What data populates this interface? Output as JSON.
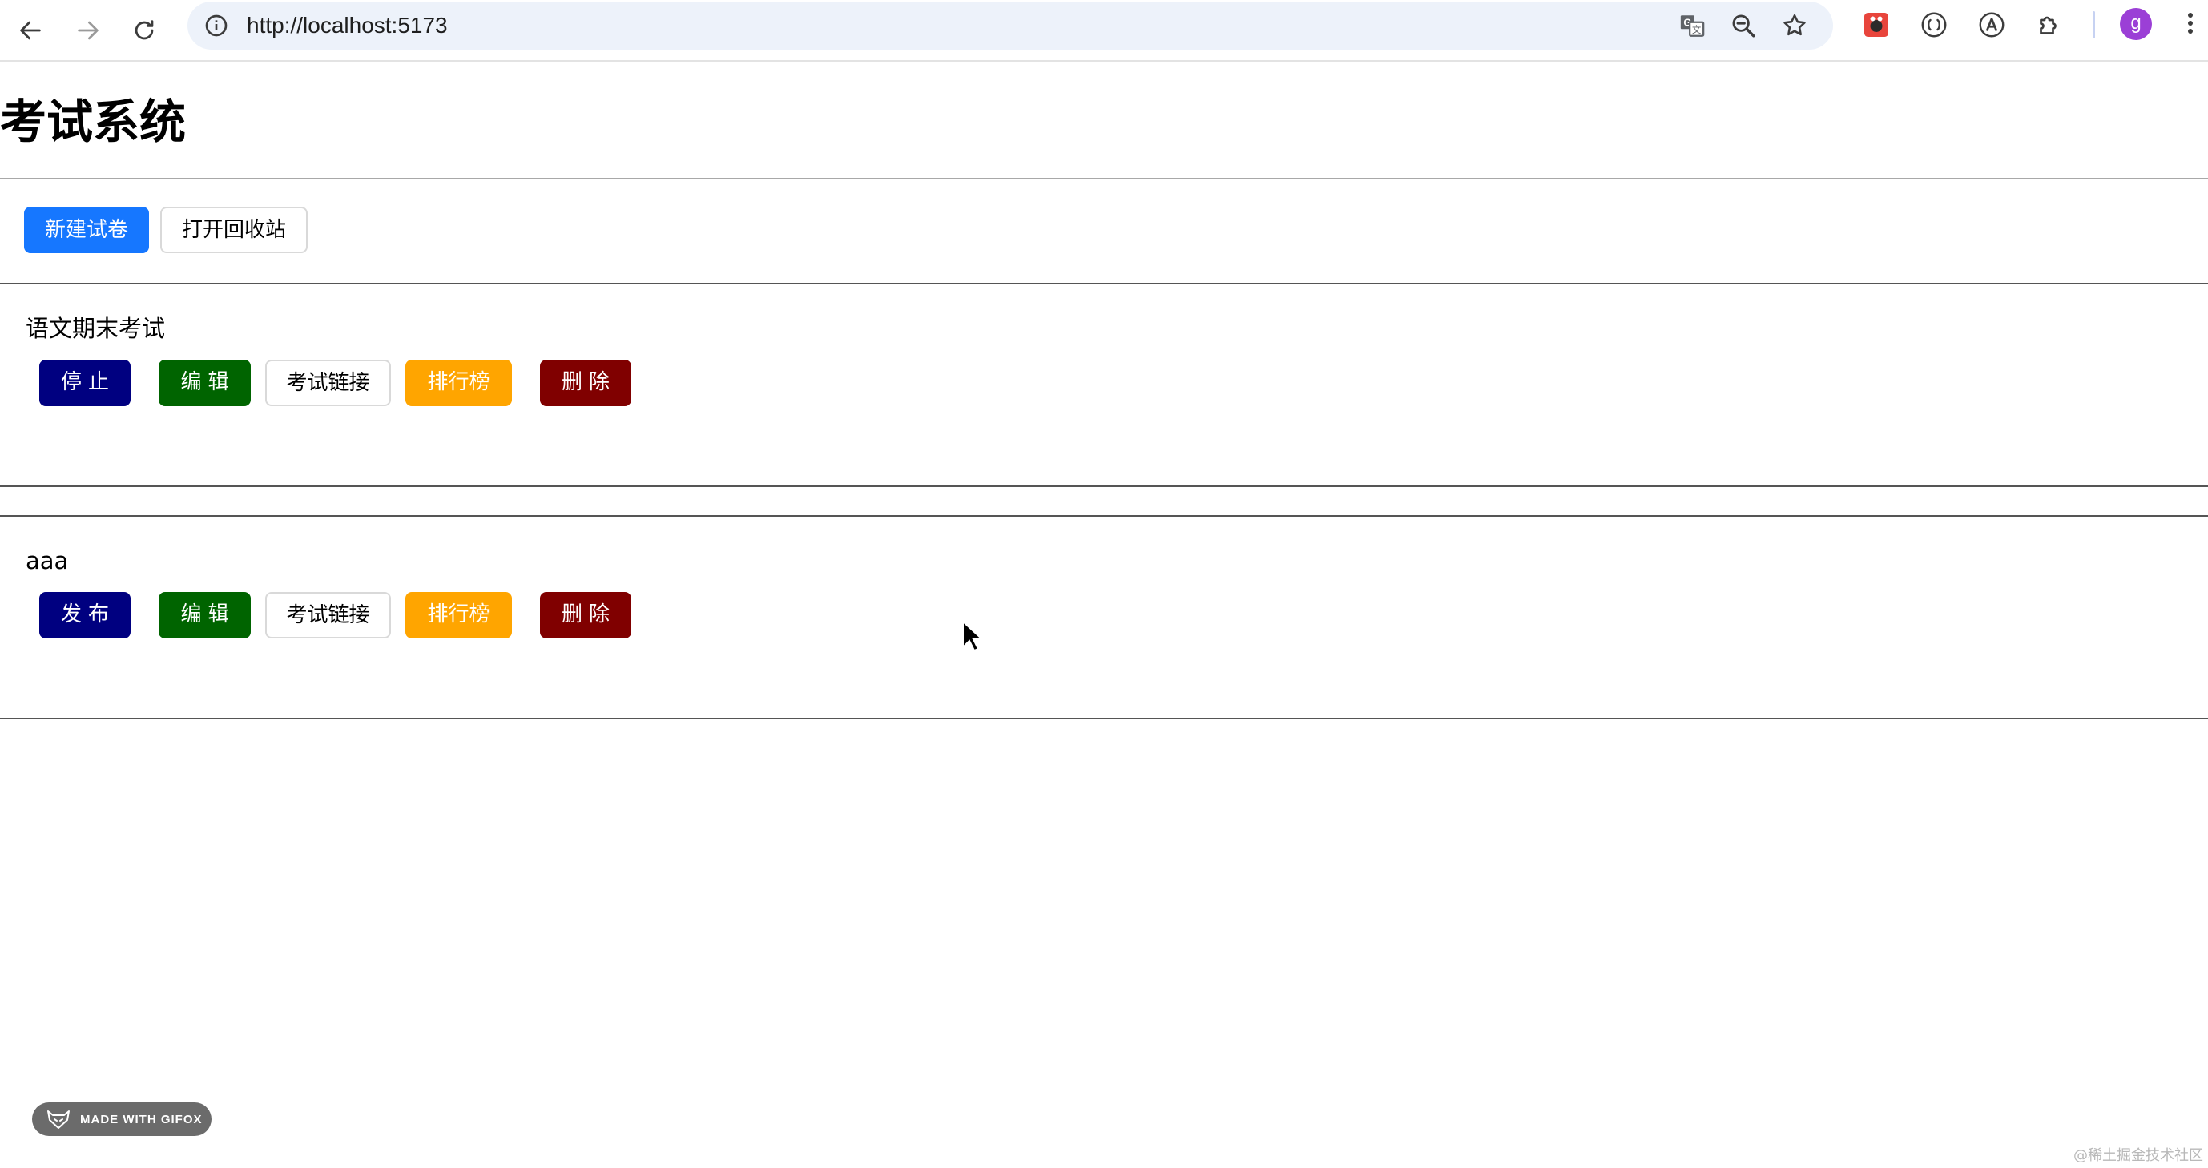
{
  "browser": {
    "url": "http://localhost:5173",
    "avatar_letter": "g",
    "icons": {
      "back": "arrow-left-icon",
      "forward": "arrow-right-icon",
      "reload": "reload-icon",
      "site_info": "info-icon",
      "translate": "translate-icon",
      "zoom": "zoom-out-icon",
      "bookmark": "star-icon",
      "extension_red": "bug-icon",
      "extension_bracket": "bracket-icon",
      "extension_font": "font-a-icon",
      "extensions": "puzzle-icon",
      "menu": "kebab-menu-icon"
    }
  },
  "page": {
    "title": "考试系统",
    "toolbar": {
      "new_exam": "新建试卷",
      "open_recycle_bin": "打开回收站"
    },
    "exams": [
      {
        "name": "语文期末考试",
        "toggle_label": "停止",
        "edit_label": "编辑",
        "link_label": "考试链接",
        "rank_label": "排行榜",
        "delete_label": "删除"
      },
      {
        "name": "aaa",
        "toggle_label": "发布",
        "edit_label": "编辑",
        "link_label": "考试链接",
        "rank_label": "排行榜",
        "delete_label": "删除"
      }
    ]
  },
  "overlay": {
    "gifox_badge": "MADE WITH GIFOX",
    "watermark": "@稀土掘金技术社区"
  },
  "colors": {
    "primary": "#1677ff",
    "navy": "#000080",
    "green": "#006400",
    "orange": "#ffa500",
    "maroon": "#800000"
  }
}
